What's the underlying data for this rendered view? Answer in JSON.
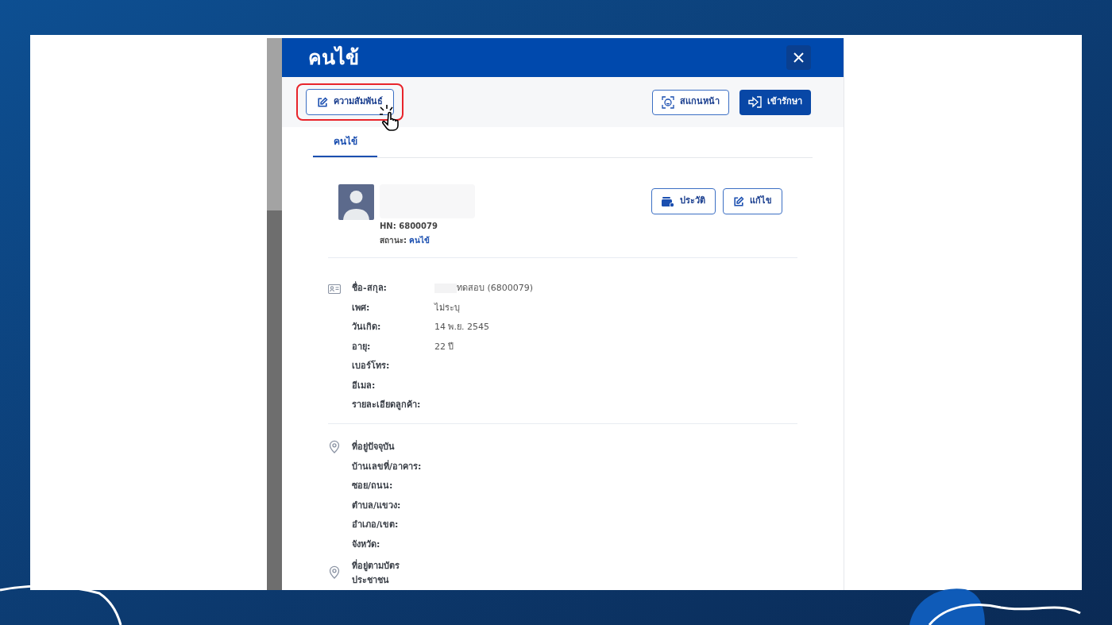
{
  "modal": {
    "title": "คนไข้"
  },
  "toolbar": {
    "relationship_button": {
      "label": "ความสัมพันธ์",
      "highlighted": true
    },
    "scan_button": {
      "label": "สแกนหน้า"
    },
    "admit_button": {
      "label": "เข้ารักษา"
    }
  },
  "tabs": [
    {
      "label": "คนไข้",
      "selected": true
    }
  ],
  "profile": {
    "hn": "HN: 6800079",
    "status_label": "สถานะ:",
    "status_value": "คนไข้",
    "buttons": [
      {
        "kind": "history",
        "label": "ประวัติ"
      },
      {
        "kind": "edit",
        "label": "แก้ไข"
      }
    ]
  },
  "personal": {
    "rows": [
      {
        "label": "ชื่อ-สกุล:",
        "value": "ทดสอบ (6800079)",
        "redacted_prefix": true
      },
      {
        "label": "เพศ:",
        "value": "ไม่ระบุ"
      },
      {
        "label": "วันเกิด:",
        "value": "14 พ.ย. 2545"
      },
      {
        "label": "อายุ:",
        "value": "22 ปี"
      },
      {
        "label": "เบอร์โทร:"
      },
      {
        "label": "อีเมล:"
      },
      {
        "label": "รายละเอียดลูกค้า:"
      }
    ]
  },
  "addresses": [
    {
      "title_lines": [
        "ที่อยู่ปัจจุบัน"
      ],
      "rows": [
        {
          "label": "บ้านเลขที่/อาคาร:"
        },
        {
          "label": "ซอย/ถนน:"
        },
        {
          "label": "ตำบล/แขวง:"
        },
        {
          "label": "อำเภอ/เขต:"
        },
        {
          "label": "จังหวัด:"
        }
      ]
    },
    {
      "title_lines": [
        "ที่อยู่ตามบัตร",
        "ประชาชน"
      ]
    }
  ]
}
